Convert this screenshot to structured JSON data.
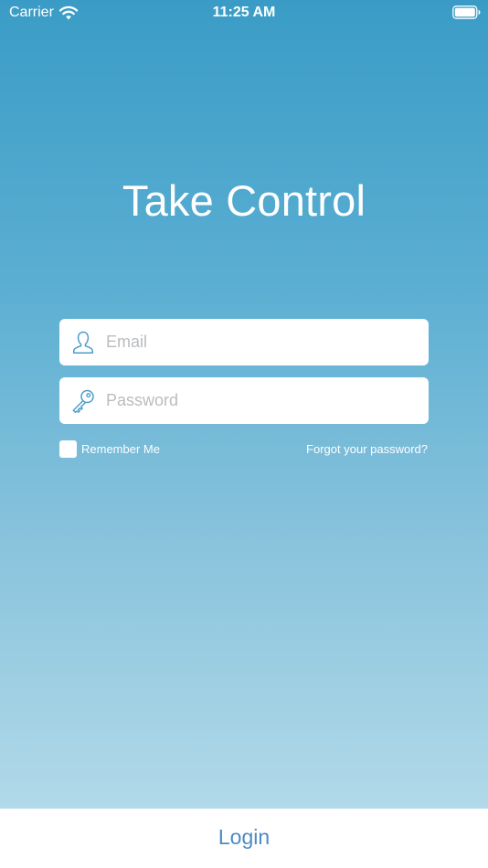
{
  "status_bar": {
    "carrier": "Carrier",
    "time": "11:25 AM",
    "wifi_icon": "wifi-icon",
    "battery_icon": "battery-icon"
  },
  "title": "Take Control",
  "form": {
    "email": {
      "placeholder": "Email",
      "value": "",
      "icon": "user-icon"
    },
    "password": {
      "placeholder": "Password",
      "value": "",
      "icon": "key-icon"
    },
    "remember_label": "Remember Me",
    "remember_checked": false,
    "forgot_label": "Forgot your password?"
  },
  "login_label": "Login",
  "colors": {
    "gradient_top": "#3a9cc6",
    "gradient_bottom": "#b6dcea",
    "accent": "#4d8ac4",
    "icon_stroke": "#4b9ec9",
    "placeholder": "#b9bcc0"
  }
}
